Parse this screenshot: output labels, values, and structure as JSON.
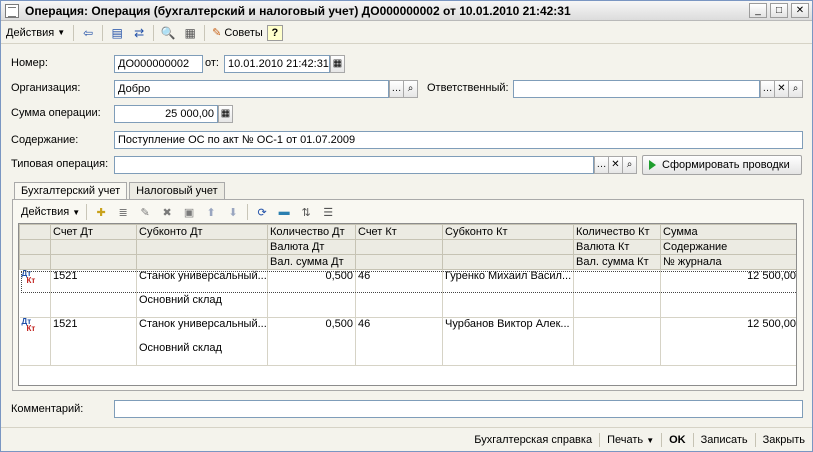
{
  "window": {
    "title": "Операция: Операция (бухгалтерский и налоговый учет) ДО000000002 от 10.01.2010 21:42:31",
    "btn_min": "_",
    "btn_max": "□",
    "btn_close": "✕"
  },
  "toolbar": {
    "actions_label": "Действия",
    "advice_label": "Советы",
    "help_label": "?"
  },
  "form": {
    "number_label": "Номер:",
    "number_value": "ДО000000002",
    "date_label": "от:",
    "date_value": "10.01.2010 21:42:31",
    "org_label": "Организация:",
    "org_value": "Добро",
    "responsible_label": "Ответственный:",
    "responsible_value": "",
    "sum_label": "Сумма операции:",
    "sum_value": "25 000,00",
    "content_label": "Содержание:",
    "content_value": "Поступление ОС по акт № ОС-1 от 01.07.2009",
    "typical_label": "Типовая операция:",
    "typical_value": "",
    "generate_label": "Сформировать проводки",
    "comment_label": "Комментарий:",
    "comment_value": ""
  },
  "tabs": [
    {
      "label": "Бухгалтерский учет",
      "active": true
    },
    {
      "label": "Налоговый учет",
      "active": false
    }
  ],
  "subtoolbar": {
    "actions_label": "Действия"
  },
  "grid": {
    "headers": {
      "r1": [
        "Счет Дт",
        "Субконто Дт",
        "Количество Дт",
        "Счет Кт",
        "Субконто Кт",
        "Количество Кт",
        "Сумма"
      ],
      "r2": [
        "Валюта Дт",
        "Валюта Кт",
        "Содержание"
      ],
      "r3": [
        "Вал. сумма Дт",
        "Вал. сумма Кт",
        "№ журнала"
      ]
    },
    "rows": [
      {
        "dt_label": "Дт",
        "kt_label": "Кт",
        "account_dt": "1521",
        "subconto_dt_1": "Станок универсальный...",
        "subconto_dt_2": "Основний склад",
        "qty_dt": "0,500",
        "account_kt": "46",
        "subconto_kt": "Гуренко Михаил Васил...",
        "qty_kt": "",
        "sum": "12 500,00"
      },
      {
        "dt_label": "Дт",
        "kt_label": "Кт",
        "account_dt": "1521",
        "subconto_dt_1": "Станок универсальный...",
        "subconto_dt_2": "Основний склад",
        "qty_dt": "0,500",
        "account_kt": "46",
        "subconto_kt": "Чурбанов Виктор Алек...",
        "qty_kt": "",
        "sum": "12 500,00"
      }
    ]
  },
  "statusbar": {
    "report": "Бухгалтерская справка",
    "print": "Печать",
    "ok": "OK",
    "save": "Записать",
    "close": "Закрыть"
  }
}
